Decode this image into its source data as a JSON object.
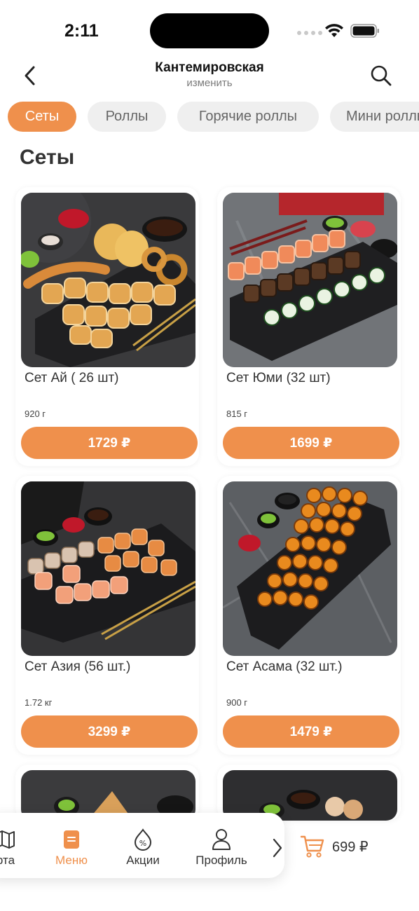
{
  "status_bar": {
    "time": "2:11"
  },
  "header": {
    "title": "Кантемировская",
    "subtitle": "изменить"
  },
  "tabs": [
    {
      "label": "Сеты",
      "active": true
    },
    {
      "label": "Роллы",
      "active": false
    },
    {
      "label": "Горячие роллы",
      "active": false
    },
    {
      "label": "Мини роллы",
      "active": false
    }
  ],
  "section": {
    "title": "Сеты"
  },
  "products": [
    {
      "name": "Сет Ай ( 26 шт)",
      "weight": "920 г",
      "price": "1729 ₽",
      "image": "sushi-set-tempura"
    },
    {
      "name": "Сет Юми (32 шт)",
      "weight": "815 г",
      "price": "1699 ₽",
      "image": "sushi-set-rolls"
    },
    {
      "name": "Сет Азия (56 шт.)",
      "weight": "1.72 кг",
      "price": "3299 ₽",
      "image": "sushi-set-assorted"
    },
    {
      "name": "Сет Асама (32 шт.)",
      "weight": "900 г",
      "price": "1479 ₽",
      "image": "sushi-set-baked"
    }
  ],
  "bottom_nav": {
    "items": [
      {
        "label": "рта",
        "icon": "map-icon",
        "active": false
      },
      {
        "label": "Меню",
        "icon": "menu-icon",
        "active": true
      },
      {
        "label": "Акции",
        "icon": "discount-icon",
        "active": false
      },
      {
        "label": "Профиль",
        "icon": "profile-icon",
        "active": false
      }
    ],
    "cart_total": "699 ₽"
  },
  "colors": {
    "accent": "#ef904c",
    "tab_inactive": "#efefef"
  }
}
